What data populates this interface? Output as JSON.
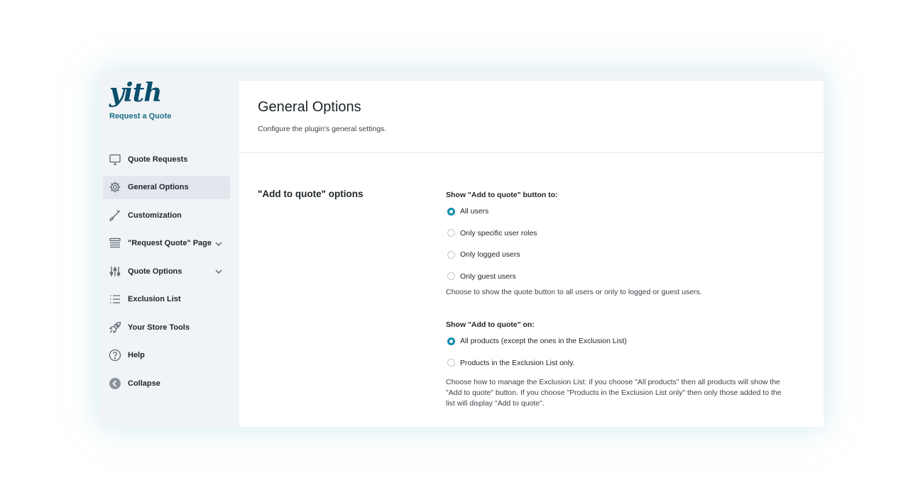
{
  "brand": {
    "logo_text": "yith",
    "subtitle": "Request a Quote"
  },
  "sidebar": {
    "items": [
      {
        "label": "Quote Requests",
        "icon": "monitor-icon"
      },
      {
        "label": "General Options",
        "icon": "gear-icon",
        "active": true
      },
      {
        "label": "Customization",
        "icon": "brush-icon"
      },
      {
        "label": "\"Request Quote\" Page",
        "icon": "layers-icon",
        "expandable": true
      },
      {
        "label": "Quote Options",
        "icon": "sliders-icon",
        "expandable": true
      },
      {
        "label": "Exclusion List",
        "icon": "list-icon"
      },
      {
        "label": "Your Store Tools",
        "icon": "rocket-icon"
      },
      {
        "label": "Help",
        "icon": "help-icon"
      },
      {
        "label": "Collapse",
        "icon": "collapse-icon"
      }
    ]
  },
  "header": {
    "title": "General Options",
    "description": "Configure the plugin's general settings."
  },
  "section": {
    "title": "\"Add to quote\" options",
    "show_to": {
      "label": "Show \"Add to quote\" button to:",
      "options": [
        "All users",
        "Only specific user roles",
        "Only logged users",
        "Only guest users"
      ],
      "selected": "All users",
      "help": "Choose to show the quote button to all users or only to logged or guest users."
    },
    "show_on": {
      "label": "Show \"Add to quote\" on:",
      "options": [
        "All products (except the ones in the Exclusion List)",
        "Products in the Exclusion List only."
      ],
      "selected": "All products (except the ones in the Exclusion List)",
      "help": "Choose how to manage the Exclusion List: if you choose \"All products\" then all products will show the \"Add to quote\" button. If you choose \"Products in the Exclusion List only\" then only those added to the list will display \"Add to quote\"."
    }
  },
  "colors": {
    "accent": "#0f8cab",
    "brand": "#0b4f6c",
    "sidebar_bg": "#f1f4f7",
    "active_item_bg": "#e2e7ed"
  }
}
